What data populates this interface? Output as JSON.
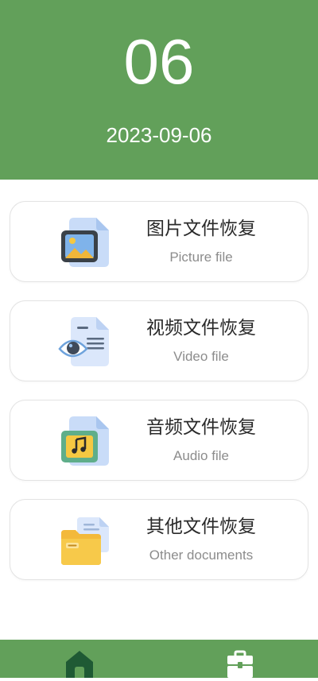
{
  "header": {
    "day": "06",
    "date": "2023-09-06"
  },
  "cards": [
    {
      "title": "图片文件恢复",
      "subtitle": "Picture file",
      "icon": "picture-file-icon"
    },
    {
      "title": "视频文件恢复",
      "subtitle": "Video file",
      "icon": "video-file-icon"
    },
    {
      "title": "音频文件恢复",
      "subtitle": "Audio file",
      "icon": "audio-file-icon"
    },
    {
      "title": "其他文件恢复",
      "subtitle": "Other documents",
      "icon": "folder-file-icon"
    }
  ],
  "nav": {
    "items": [
      {
        "icon": "home-icon"
      },
      {
        "icon": "toolbox-icon"
      }
    ]
  },
  "colors": {
    "primary": "#62a05a",
    "home_icon": "#1f5a34",
    "card_border": "#e3e3e3",
    "title_text": "#2a2a2a",
    "subtitle_text": "#8c8c8c"
  }
}
